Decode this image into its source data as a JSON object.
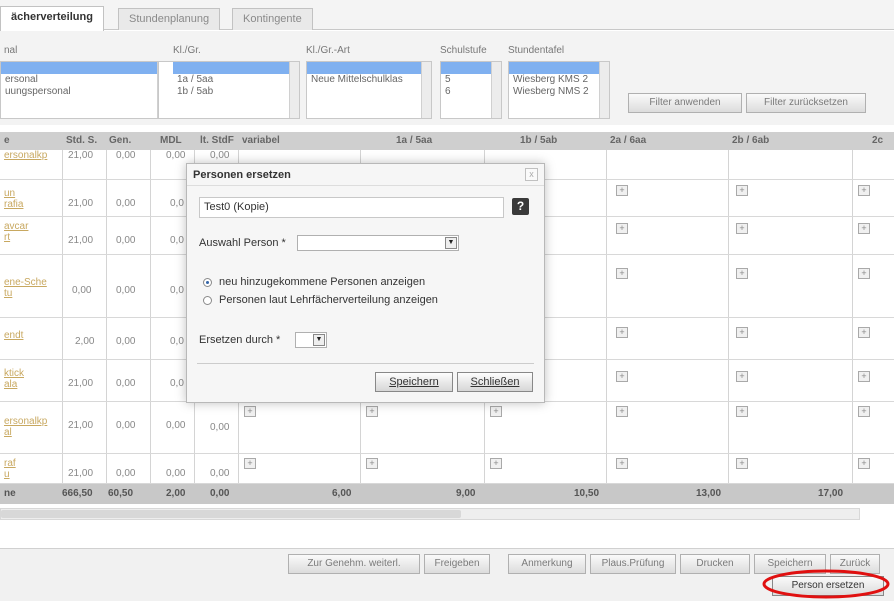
{
  "tabs": [
    {
      "label": "ächerverteilung",
      "active": true
    },
    {
      "label": "Stundenplanung",
      "active": false
    },
    {
      "label": "Kontingente",
      "active": false
    }
  ],
  "filters": {
    "personal": {
      "label": "nal",
      "options": [
        "",
        "ersonal",
        "uungspersonal"
      ]
    },
    "klgr": {
      "label": "Kl./Gr.",
      "options": [
        "",
        "1a / 5aa",
        "1b / 5ab"
      ]
    },
    "klgrart": {
      "label": "Kl./Gr.-Art",
      "options": [
        "",
        "Neue Mittelschulklas"
      ]
    },
    "schulstufe": {
      "label": "Schulstufe",
      "options": [
        "",
        "5",
        "6"
      ]
    },
    "stundentafel": {
      "label": "Stundentafel",
      "options": [
        "",
        "Wiesberg KMS 2",
        "Wiesberg NMS 2"
      ]
    },
    "apply_label": "Filter anwenden",
    "reset_label": "Filter zurücksetzen"
  },
  "table": {
    "headers": [
      "e",
      "Std. S.",
      "Gen.",
      "MDL",
      "lt. StdF",
      "variabel",
      "1a / 5aa",
      "1b / 5ab",
      "2a / 6aa",
      "2b / 6ab",
      "2c"
    ],
    "rows": [
      {
        "name": "ersonalkp",
        "std": "21,00",
        "gen": "0,00",
        "mdl": "0,00",
        "stdf": "0,00"
      },
      {
        "name": "un\nrafia",
        "std": "21,00",
        "gen": "0,00",
        "mdl": "0,0",
        "stdf": ""
      },
      {
        "name": "avcar\nrt",
        "std": "21,00",
        "gen": "0,00",
        "mdl": "0,0",
        "stdf": ""
      },
      {
        "name": "ene-Sche\ntu",
        "std": "0,00",
        "gen": "0,00",
        "mdl": "0,0",
        "stdf": ""
      },
      {
        "name": "endt",
        "std": "2,00",
        "gen": "0,00",
        "mdl": "0,0",
        "stdf": ""
      },
      {
        "name": "ktick\nala",
        "std": "21,00",
        "gen": "0,00",
        "mdl": "0,0",
        "stdf": ""
      },
      {
        "name": "ersonalkp\nal",
        "std": "21,00",
        "gen": "0,00",
        "mdl": "0,00",
        "stdf": "0,00"
      },
      {
        "name": "raf\nu",
        "std": "21,00",
        "gen": "0,00",
        "mdl": "0,00",
        "stdf": "0,00"
      }
    ],
    "sum": {
      "label": "ne",
      "std": "666,50",
      "gen": "60,50",
      "mdl": "2,00",
      "stdf": "0,00",
      "c1": "6,00",
      "c2": "9,00",
      "c3": "10,50",
      "c4": "13,00",
      "c5": "17,00"
    }
  },
  "bottom_buttons": [
    "Zur Genehm. weiterl.",
    "Freigeben",
    "Anmerkung",
    "Plaus.Prüfung",
    "Drucken",
    "Speichern",
    "Zurück"
  ],
  "person_ersetzen_label": "Person ersetzen",
  "highlight_color": "#e01010",
  "dialog": {
    "title": "Personen ersetzen",
    "close": "x",
    "name_value": "Test0 (Kopie)",
    "auswahl_label": "Auswahl Person *",
    "radio_new": "neu hinzugekommene Personen anzeigen",
    "radio_ltv": "Personen laut Lehrfächerverteilung anzeigen",
    "ersetzen_label": "Ersetzen durch *",
    "save_label": "Speichern",
    "close_label": "Schließen",
    "help": "?"
  }
}
